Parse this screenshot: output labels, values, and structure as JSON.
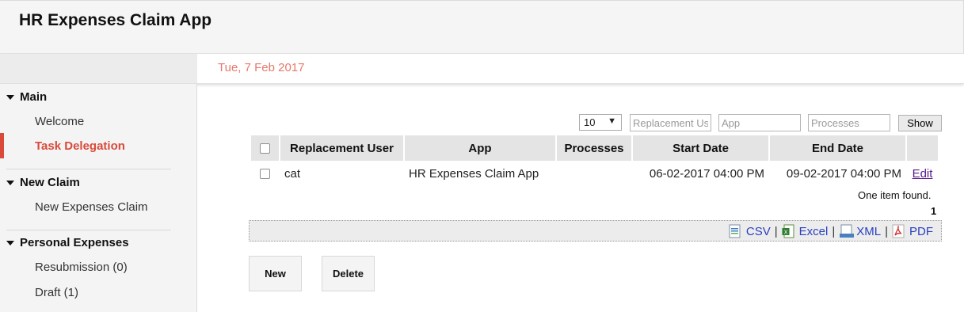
{
  "app": {
    "title": "HR Expenses Claim App"
  },
  "header": {
    "date": "Tue, 7 Feb 2017"
  },
  "sidebar": {
    "sections": [
      {
        "title": "Main",
        "items": [
          {
            "label": "Welcome"
          },
          {
            "label": "Task Delegation",
            "active": true
          }
        ]
      },
      {
        "title": "New Claim",
        "items": [
          {
            "label": "New Expenses Claim"
          }
        ]
      },
      {
        "title": "Personal Expenses",
        "items": [
          {
            "label": "Resubmission (0)"
          },
          {
            "label": "Draft (1)"
          }
        ]
      }
    ]
  },
  "filters": {
    "page_size": "10",
    "replacement_user_placeholder": "Replacement User",
    "app_placeholder": "App",
    "processes_placeholder": "Processes",
    "show_label": "Show"
  },
  "table": {
    "columns": [
      "Replacement User",
      "App",
      "Processes",
      "Start Date",
      "End Date"
    ],
    "rows": [
      {
        "replacement_user": "cat",
        "app": "HR Expenses Claim App",
        "processes": "",
        "start_date": "06-02-2017 04:00 PM",
        "end_date": "09-02-2017 04:00 PM",
        "action": "Edit"
      }
    ],
    "status": "One item found.",
    "page": "1"
  },
  "export": {
    "csv": "CSV",
    "excel": "Excel",
    "xml": "XML",
    "pdf": "PDF"
  },
  "actions": {
    "new_label": "New",
    "delete_label": "Delete"
  },
  "colors": {
    "accent": "#d94a3a",
    "date": "#e8776a",
    "link": "#2a3fbf",
    "visited_link": "#551a8b"
  },
  "icons": {
    "csv": "csv-file-icon",
    "excel": "excel-file-icon",
    "xml": "xml-file-icon",
    "pdf": "pdf-file-icon"
  }
}
